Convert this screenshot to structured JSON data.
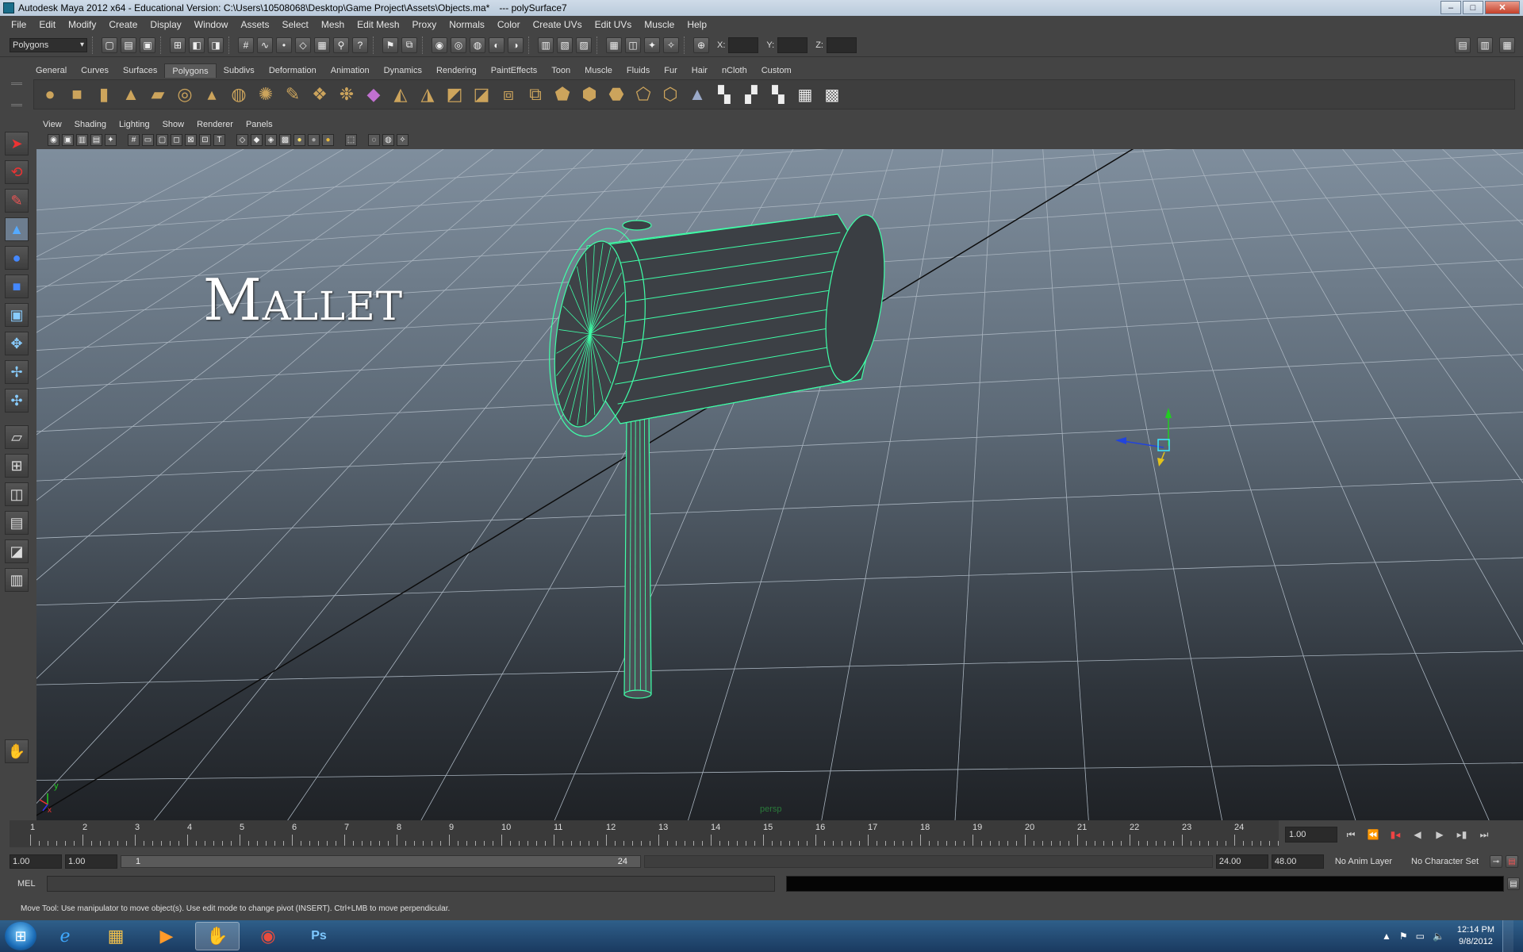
{
  "window": {
    "title": "Autodesk Maya 2012 x64 - Educational Version: C:\\Users\\10508068\\Desktop\\Game Project\\Assets\\Objects.ma*",
    "title_extra": "---   polySurface7",
    "min": "–",
    "max": "□",
    "close": "✕"
  },
  "menu": [
    "File",
    "Edit",
    "Modify",
    "Create",
    "Display",
    "Window",
    "Assets",
    "Select",
    "Mesh",
    "Edit Mesh",
    "Proxy",
    "Normals",
    "Color",
    "Create UVs",
    "Edit UVs",
    "Muscle",
    "Help"
  ],
  "statusline": {
    "mode": "Polygons",
    "x_label": "X:",
    "y_label": "Y:",
    "z_label": "Z:"
  },
  "shelf": {
    "tabs": [
      "General",
      "Curves",
      "Surfaces",
      "Polygons",
      "Subdivs",
      "Deformation",
      "Animation",
      "Dynamics",
      "Rendering",
      "PaintEffects",
      "Toon",
      "Muscle",
      "Fluids",
      "Fur",
      "Hair",
      "nCloth",
      "Custom"
    ],
    "active_tab": "Polygons"
  },
  "panel": {
    "menu": [
      "View",
      "Shading",
      "Lighting",
      "Show",
      "Renderer",
      "Panels"
    ],
    "camera": "persp"
  },
  "viewport": {
    "overlay_text": "Mallet",
    "axis_y": "y",
    "axis_x": "x",
    "wire_color": "#3fffa8",
    "grid_color": "#a9b4bf"
  },
  "timeline": {
    "ticks": [
      "1",
      "2",
      "3",
      "4",
      "5",
      "6",
      "7",
      "8",
      "9",
      "10",
      "11",
      "12",
      "13",
      "14",
      "15",
      "16",
      "17",
      "18",
      "19",
      "20",
      "21",
      "22",
      "23",
      "24"
    ],
    "current_time": "1.00"
  },
  "range": {
    "start_time": "1.00",
    "playback_start": "1.00",
    "slider_start": "1",
    "slider_end": "24",
    "playback_end": "24.00",
    "end_time": "48.00",
    "anim_layer": "No Anim Layer",
    "character_set": "No Character Set"
  },
  "command": {
    "label": "MEL"
  },
  "help_line": "Move Tool: Use manipulator to move object(s). Use edit mode to change pivot (INSERT).  Ctrl+LMB to move perpendicular.",
  "taskbar": {
    "time": "12:14 PM",
    "date": "9/8/2012",
    "apps": [
      "ie-icon",
      "explorer-icon",
      "media-player-icon",
      "maya-icon",
      "chrome-icon",
      "photoshop-icon"
    ]
  }
}
